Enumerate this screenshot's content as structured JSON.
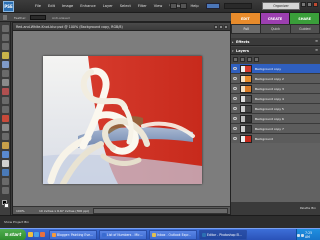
{
  "menubar": {
    "logo": "PSE",
    "items": [
      "File",
      "Edit",
      "Image",
      "Enhance",
      "Layer",
      "Select",
      "Filter",
      "View",
      "Window",
      "Help"
    ],
    "organizer_label": "Organizer"
  },
  "options_bar": {
    "label": "Feather:",
    "extra": "Anti-aliased"
  },
  "mode_tabs": [
    "EDIT",
    "CREATE",
    "SHARE"
  ],
  "edit_subtabs": [
    "Full",
    "Quick",
    "Guided"
  ],
  "document": {
    "title": "Red-and-White-Knot-blur.psd @ 100% (Background copy, RGB/8)",
    "zoom": "100%",
    "info": "10 inches x 6.67 inches (300 ppi)"
  },
  "panels": {
    "effects_title": "Effects",
    "layers_title": "Layers",
    "palette_bin_label": "Palette Bin",
    "layers": [
      {
        "name": "Background copy",
        "selected": true,
        "thumb": "color"
      },
      {
        "name": "Background copy 2",
        "selected": false,
        "thumb": "orange"
      },
      {
        "name": "Background copy 3",
        "selected": false,
        "thumb": "orange"
      },
      {
        "name": "Background copy 4",
        "selected": false,
        "thumb": "gray"
      },
      {
        "name": "Background copy 5",
        "selected": false,
        "thumb": "gray"
      },
      {
        "name": "Background copy 6",
        "selected": false,
        "thumb": "gray"
      },
      {
        "name": "Background copy 7",
        "selected": false,
        "thumb": "gray"
      },
      {
        "name": "Background",
        "selected": false,
        "thumb": "color"
      }
    ]
  },
  "project_bin_label": "Show Project Bin",
  "taskbar": {
    "start_label": "start",
    "tasks": [
      "Blogger: Painting Eve...",
      "List of Numbers - Mic...",
      "Inbox - Outlook Expr...",
      "Editor - Photoshop El..."
    ],
    "active_task_index": 3,
    "clock": "7:25 AM"
  },
  "colors": {
    "edit_tab": "#e88b2b",
    "create_tab": "#9c3fb0",
    "share_tab": "#3a9e3a",
    "selected_layer": "#2f5fbf",
    "taskbar": "#2a52b8"
  }
}
